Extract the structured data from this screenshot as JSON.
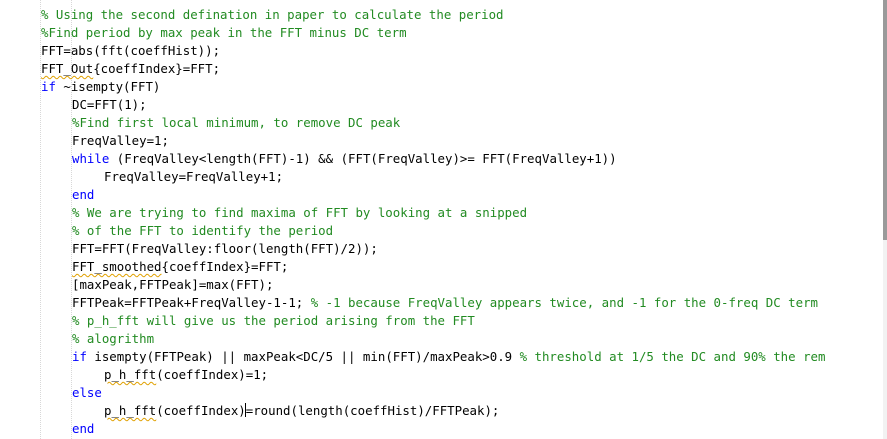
{
  "editor": {
    "language": "MATLAB",
    "colors": {
      "comment": "#228b22",
      "keyword": "#0000ff",
      "text": "#000000",
      "warning": "#e0a000"
    },
    "lines": [
      {
        "indent": 1,
        "tokens": [
          {
            "t": "c",
            "s": "% Using the second defination in paper to calculate the period"
          }
        ]
      },
      {
        "indent": 1,
        "tokens": [
          {
            "t": "c",
            "s": "%Find period by max peak in the FFT minus DC term"
          }
        ]
      },
      {
        "indent": 1,
        "tokens": [
          {
            "t": "n",
            "s": "FFT=abs(fft(coeffHist));"
          }
        ]
      },
      {
        "indent": 1,
        "tokens": [
          {
            "t": "w",
            "s": "FFT_Out"
          },
          {
            "t": "n",
            "s": "{coeffIndex}=FFT;"
          }
        ]
      },
      {
        "indent": 1,
        "tokens": [
          {
            "t": "k",
            "s": "if"
          },
          {
            "t": "n",
            "s": " ~isempty(FFT)"
          }
        ]
      },
      {
        "indent": 2,
        "tokens": [
          {
            "t": "n",
            "s": "DC=FFT(1);"
          }
        ]
      },
      {
        "indent": 2,
        "tokens": [
          {
            "t": "c",
            "s": "%Find first local minimum, to remove DC peak"
          }
        ]
      },
      {
        "indent": 2,
        "tokens": [
          {
            "t": "n",
            "s": "FreqValley=1;"
          }
        ]
      },
      {
        "indent": 2,
        "tokens": [
          {
            "t": "k",
            "s": "while"
          },
          {
            "t": "n",
            "s": " (FreqValley<length(FFT)-1) && (FFT(FreqValley)>= FFT(FreqValley+1))"
          }
        ]
      },
      {
        "indent": 3,
        "tokens": [
          {
            "t": "n",
            "s": "FreqValley=FreqValley+1;"
          }
        ]
      },
      {
        "indent": 2,
        "tokens": [
          {
            "t": "k",
            "s": "end"
          }
        ]
      },
      {
        "indent": 2,
        "tokens": [
          {
            "t": "c",
            "s": "% We are trying to find maxima of FFT by looking at a snipped"
          }
        ]
      },
      {
        "indent": 2,
        "tokens": [
          {
            "t": "c",
            "s": "% of the FFT to identify the period"
          }
        ]
      },
      {
        "indent": 2,
        "tokens": [
          {
            "t": "n",
            "s": "FFT=FFT(FreqValley:floor(length(FFT)/2));"
          }
        ]
      },
      {
        "indent": 2,
        "tokens": [
          {
            "t": "w",
            "s": "FFT_smoothed"
          },
          {
            "t": "n",
            "s": "{coeffIndex}=FFT;"
          }
        ]
      },
      {
        "indent": 2,
        "tokens": [
          {
            "t": "n",
            "s": "[maxPeak,FFTPeak]=max(FFT);"
          }
        ]
      },
      {
        "indent": 2,
        "tokens": [
          {
            "t": "n",
            "s": "FFTPeak=FFTPeak+FreqValley-1-1; "
          },
          {
            "t": "c",
            "s": "% -1 because FreqValley appears twice, and -1 for the 0-freq DC term"
          }
        ]
      },
      {
        "indent": 2,
        "tokens": [
          {
            "t": "c",
            "s": "% p_h_fft will give us the period arising from the FFT"
          }
        ]
      },
      {
        "indent": 2,
        "tokens": [
          {
            "t": "c",
            "s": "% alogrithm"
          }
        ]
      },
      {
        "indent": 2,
        "tokens": [
          {
            "t": "k",
            "s": "if"
          },
          {
            "t": "n",
            "s": " isempty(FFTPeak) || maxPeak<DC/5 || min(FFT)/maxPeak>0.9 "
          },
          {
            "t": "c",
            "s": "% threshold at 1/5 the DC and 90% the rem"
          }
        ]
      },
      {
        "indent": 3,
        "tokens": [
          {
            "t": "w",
            "s": "p_h_fft"
          },
          {
            "t": "n",
            "s": "(coeffIndex)=1;"
          }
        ]
      },
      {
        "indent": 2,
        "tokens": [
          {
            "t": "k",
            "s": "else"
          }
        ]
      },
      {
        "indent": 3,
        "tokens": [
          {
            "t": "w",
            "s": "p_h_fft"
          },
          {
            "t": "n",
            "s": "(coeffIndex)"
          },
          {
            "t": "caret",
            "s": ""
          },
          {
            "t": "n",
            "s": "=round(length(coeffHist)/FFTPeak);"
          }
        ]
      },
      {
        "indent": 2,
        "tokens": [
          {
            "t": "k",
            "s": "end"
          }
        ]
      }
    ]
  }
}
